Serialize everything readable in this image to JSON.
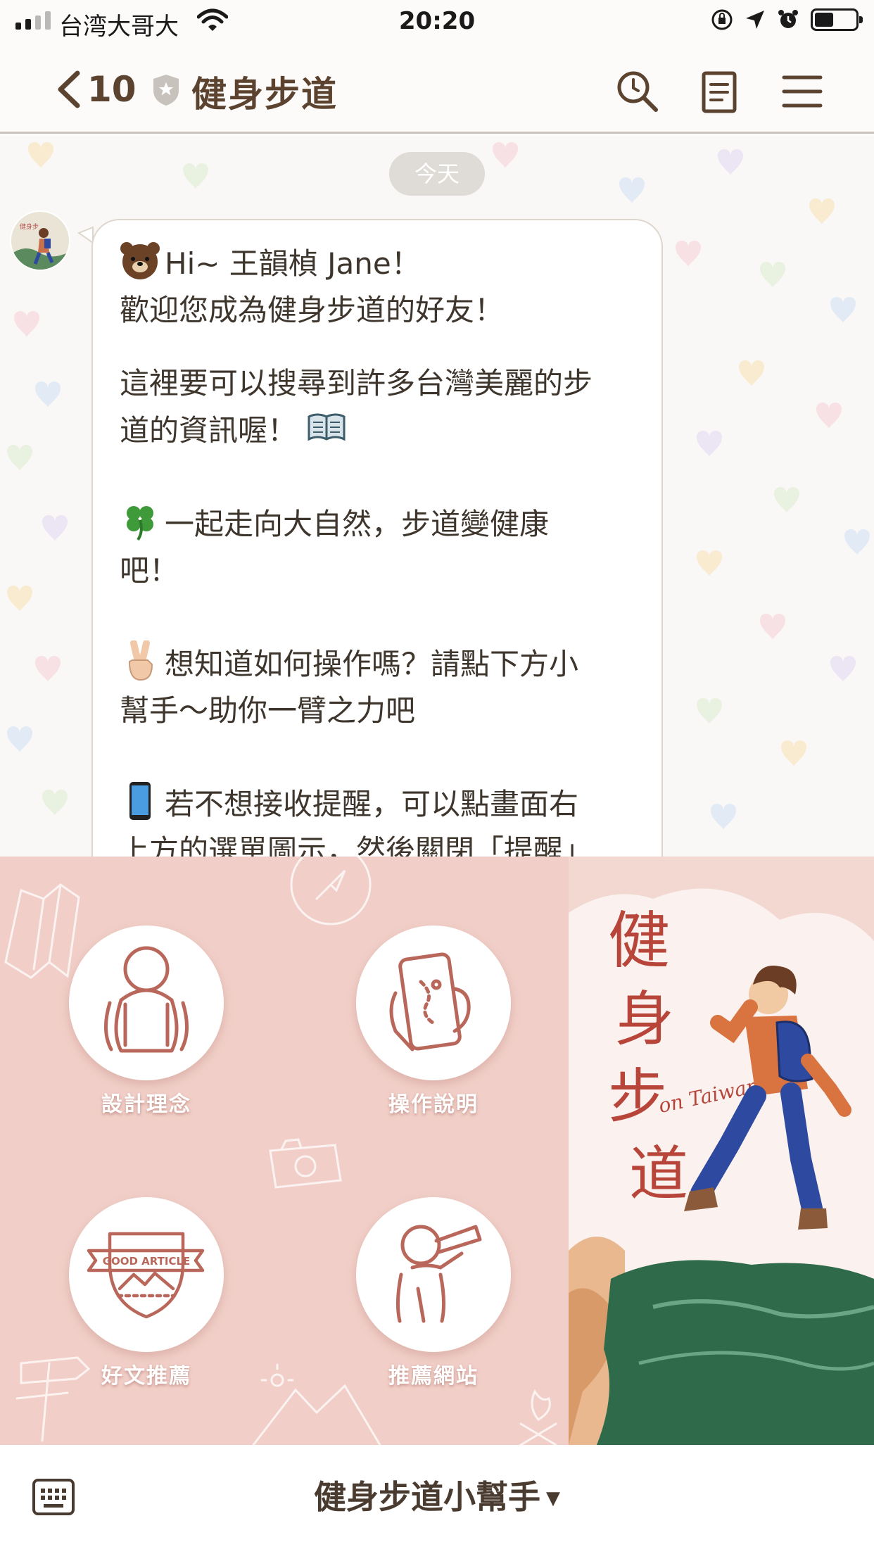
{
  "status_bar": {
    "carrier": "台湾大哥大",
    "time": "20:20"
  },
  "header": {
    "back_count": "10",
    "title": "健身步道",
    "icons": [
      "search-icon",
      "notes-icon",
      "menu-icon"
    ]
  },
  "chat": {
    "date_label": "今天",
    "message": {
      "line1": "Hi~ 王韻楨 Jane！",
      "line2": "歡迎您成為健身步道的好友！",
      "para2_line1": "這裡要可以搜尋到許多台灣美麗的步",
      "para2_line2": "道的資訊喔！",
      "para3_line1": "一起走向大自然，步道變健康",
      "para3_line2": "吧！",
      "para4_line1": "想知道如何操作嗎？請點下方小",
      "para4_line2": "幫手～助你一臂之力吧",
      "para5_line1": "若不想接收提醒，可以點畫面右",
      "para5_line2": "上方的選單圖示，然後關閉「提醒」"
    }
  },
  "rich_menu": {
    "buttons": [
      {
        "label": "設計理念"
      },
      {
        "label": "操作說明"
      },
      {
        "label": "好文推薦",
        "badge_text": "GOOD ARTICLE"
      },
      {
        "label": "推薦網站"
      }
    ],
    "art_title": "健身步道",
    "art_subtitle": "on Taiwan"
  },
  "bottom_bar": {
    "menu_title": "健身步道小幫手"
  },
  "colors": {
    "rich_menu_bg": "#f1cfc8",
    "icon_stroke": "#b9675a",
    "header_text": "#5b4330"
  }
}
